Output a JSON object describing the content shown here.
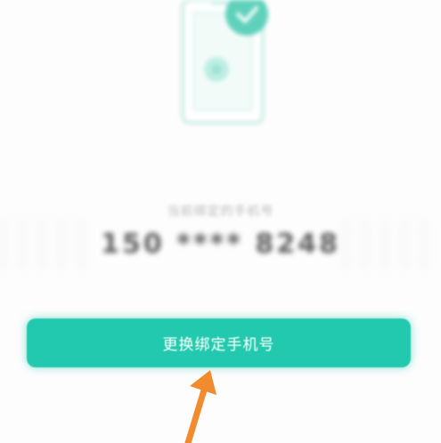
{
  "screen": {
    "bound_phone_caption": "当前绑定的手机号",
    "bound_phone_number": "150 **** 8248"
  },
  "actions": {
    "change_phone_button_label": "更换绑定手机号"
  },
  "colors": {
    "accent": "#23c9ae",
    "illustration_green": "#9be3d4",
    "annotation_arrow": "#f28a2e"
  }
}
